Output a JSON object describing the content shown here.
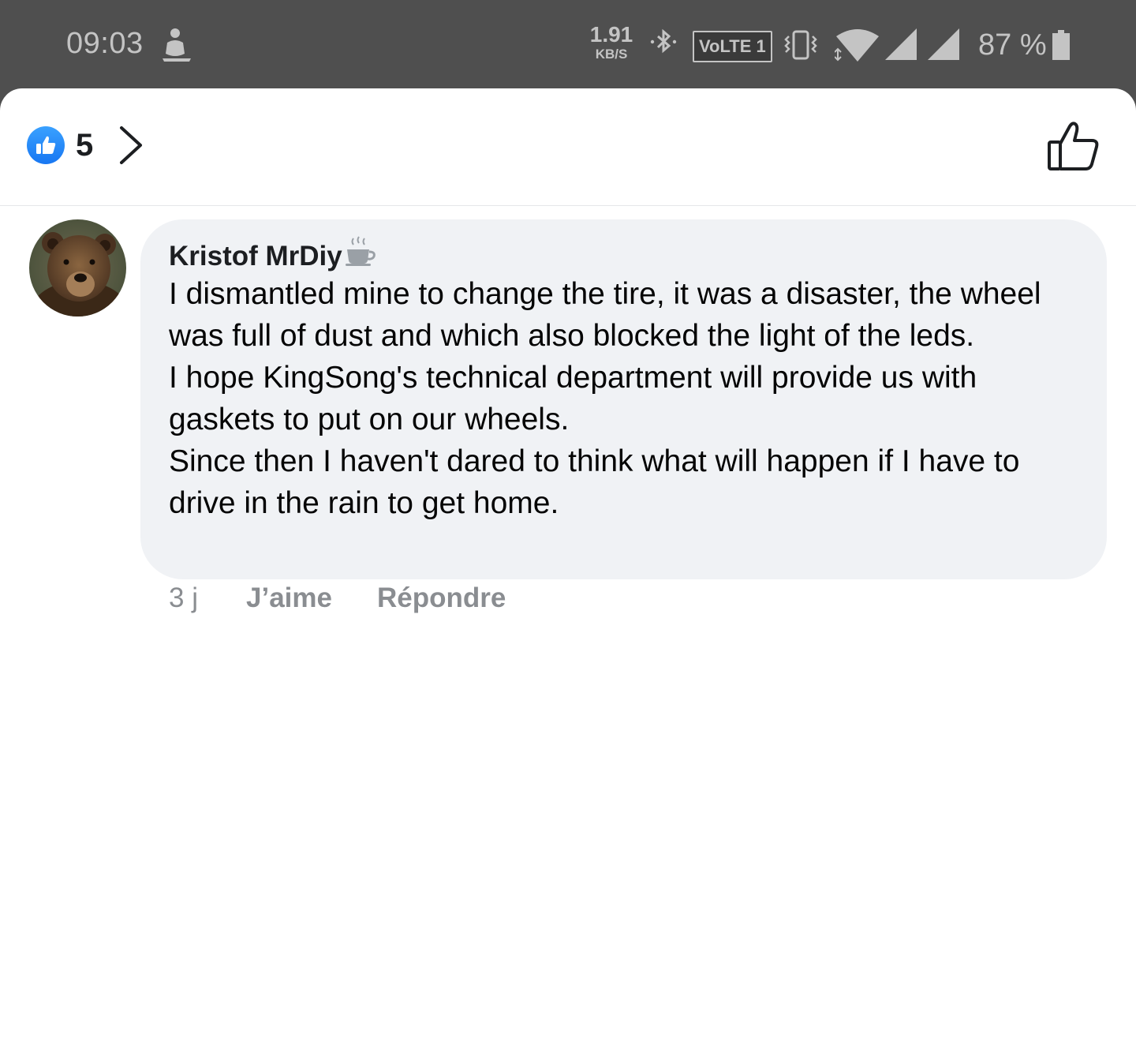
{
  "status_bar": {
    "time": "09:03",
    "speed_value": "1.91",
    "speed_unit": "KB/S",
    "volte_label": "VoLTE 1",
    "battery_percent": "87 %",
    "battery_level": 0.87,
    "icons": [
      "app-notification-icon",
      "bluetooth-icon",
      "volte-icon",
      "vibrate-icon",
      "wifi-icon",
      "signal-icon",
      "signal-icon",
      "battery-icon"
    ]
  },
  "reactions": {
    "count": "5",
    "reaction_type": "like",
    "accent_color": "#1877f2"
  },
  "comment": {
    "author": "Kristof MrDiy",
    "author_badge_icon": "coffee-cup-icon",
    "text_lines": [
      "I dismantled mine to change the tire, it was a disaster, the wheel was full of dust and which also blocked the light of the leds.",
      "I hope KingSong's technical department will provide us with gaskets to put on our wheels.",
      "Since then I haven't dared to think what will happen if I have to drive in the rain to get home."
    ],
    "time_ago": "3 j",
    "like_label": "J’aime",
    "reply_label": "Répondre"
  },
  "colors": {
    "bubble_bg": "#f0f2f5",
    "status_bar_bg": "#4f4f4f",
    "meta_text": "#8a8d91"
  }
}
